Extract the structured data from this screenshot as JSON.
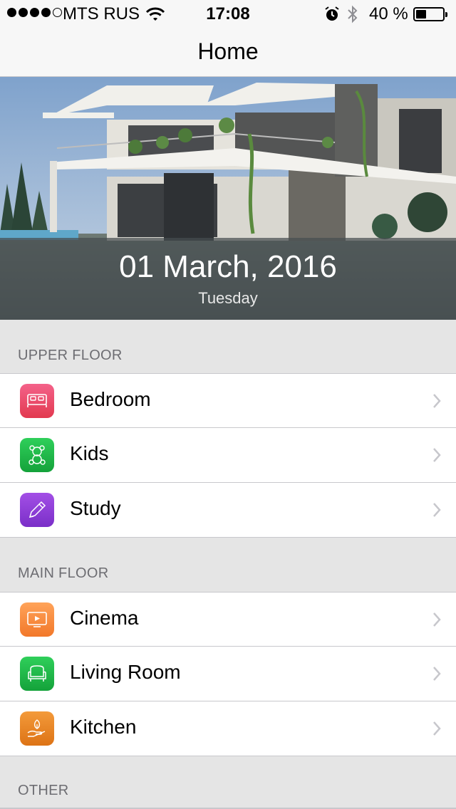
{
  "status_bar": {
    "carrier": "MTS RUS",
    "time": "17:08",
    "battery_percent": "40 %",
    "battery_level": 0.4,
    "signal_bars_filled": 4,
    "signal_bars_total": 5
  },
  "nav": {
    "title": "Home"
  },
  "hero": {
    "date": "01 March, 2016",
    "day": "Tuesday"
  },
  "sections": [
    {
      "header": "UPPER FLOOR",
      "rows": [
        {
          "label": "Bedroom",
          "icon": "bed-icon",
          "color": "#e8455f"
        },
        {
          "label": "Kids",
          "icon": "teddy-bear-icon",
          "color": "#1fb046"
        },
        {
          "label": "Study",
          "icon": "pencil-icon",
          "color": "#8b3fd6"
        }
      ]
    },
    {
      "header": "MAIN FLOOR",
      "rows": [
        {
          "label": "Cinema",
          "icon": "tv-icon",
          "color": "#f7893a"
        },
        {
          "label": "Living Room",
          "icon": "armchair-icon",
          "color": "#1fb046"
        },
        {
          "label": "Kitchen",
          "icon": "hand-leaf-icon",
          "color": "#e9801f"
        }
      ]
    },
    {
      "header": "OTHER",
      "rows": []
    }
  ]
}
